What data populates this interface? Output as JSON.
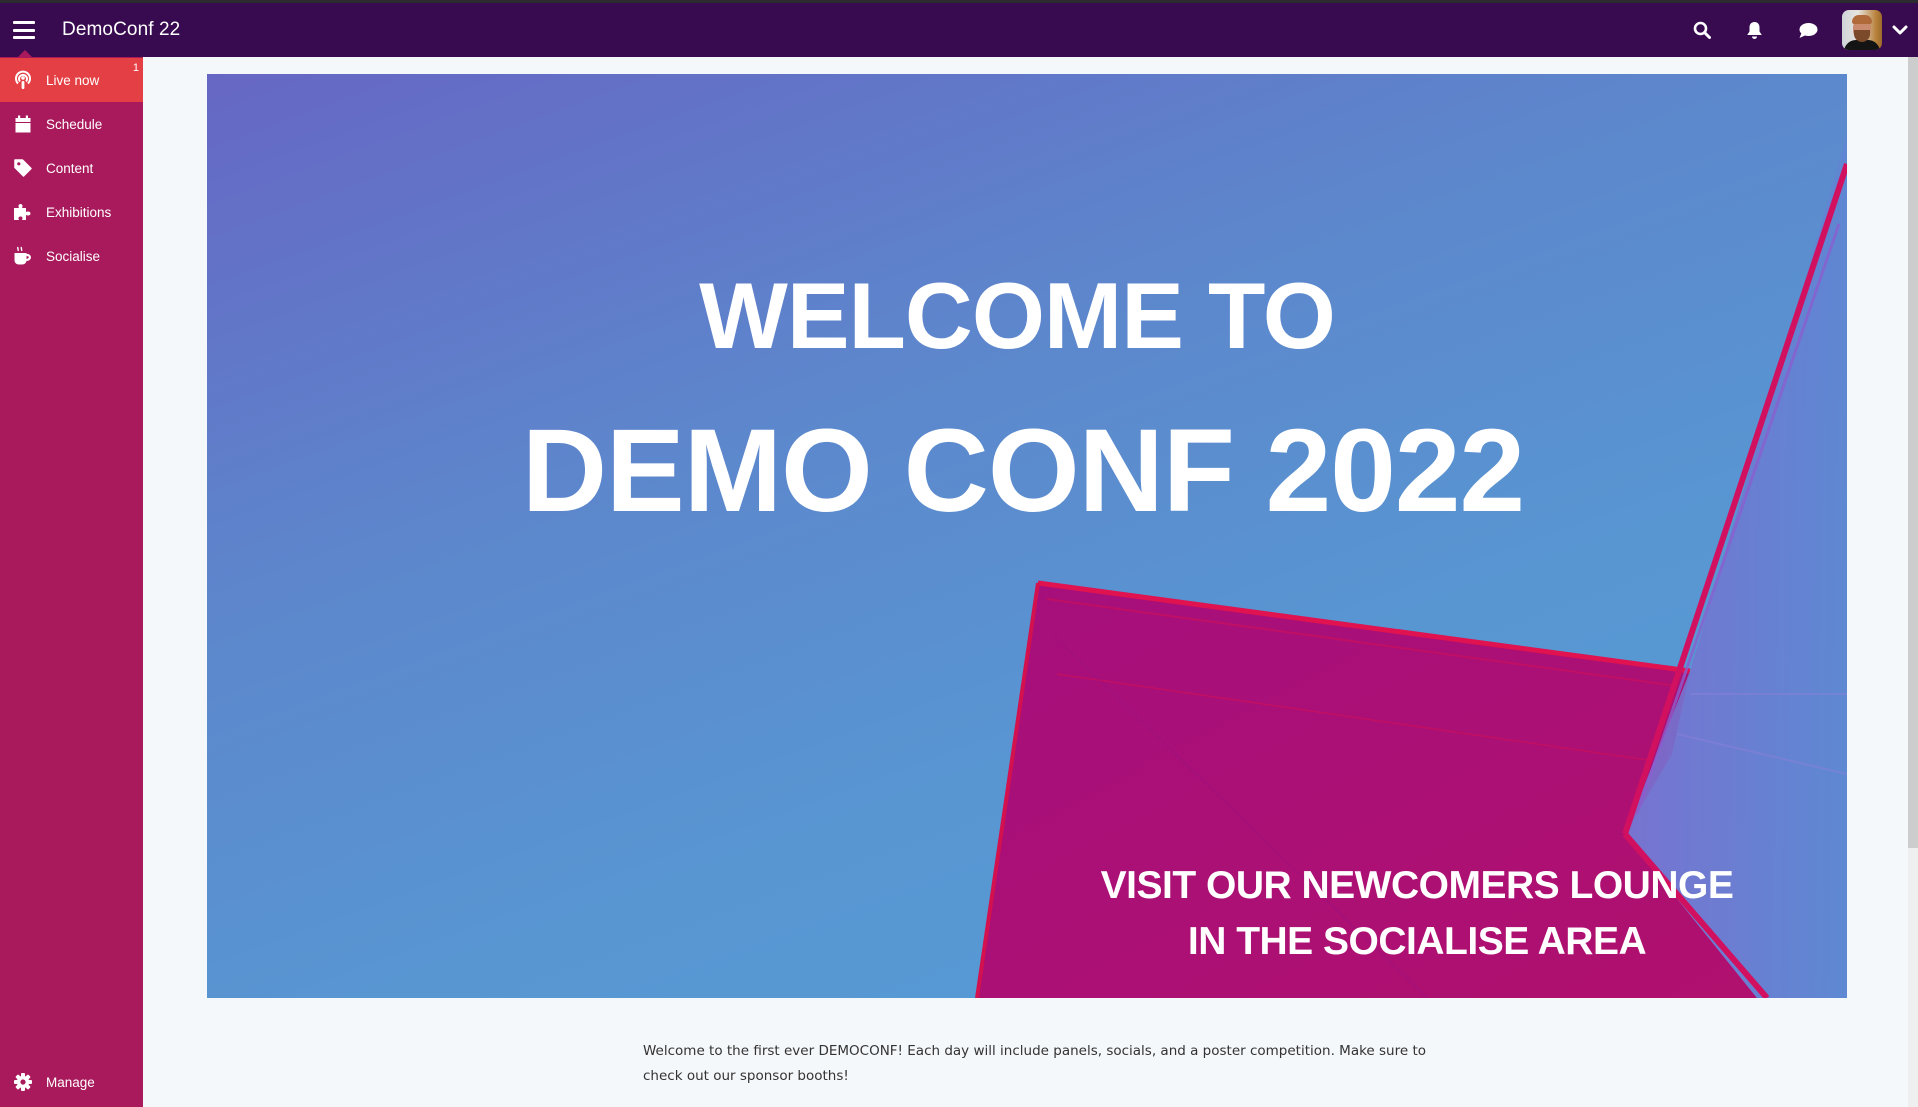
{
  "header": {
    "app_title": "DemoConf 22",
    "icons": {
      "menu": "hamburger-menu-icon",
      "search": "search-icon",
      "notifications": "bell-icon",
      "chat": "chat-bubble-icon",
      "account_menu": "chevron-down-icon"
    },
    "avatar_alt": "User avatar"
  },
  "sidebar": {
    "items": [
      {
        "label": "Live now",
        "icon": "podcast-icon",
        "badge": "1",
        "active": true
      },
      {
        "label": "Schedule",
        "icon": "calendar-icon"
      },
      {
        "label": "Content",
        "icon": "tag-icon"
      },
      {
        "label": "Exhibitions",
        "icon": "puzzle-piece-icon"
      },
      {
        "label": "Socialise",
        "icon": "coffee-cup-icon"
      }
    ],
    "footer": {
      "label": "Manage",
      "icon": "gear-icon"
    }
  },
  "banner": {
    "line1": "WELCOME TO",
    "line2": "DEMO CONF 2022",
    "callout_line1": "VISIT OUR NEWCOMERS LOUNGE",
    "callout_line2": "IN THE SOCIALISE AREA"
  },
  "intro": {
    "text": "Welcome to the first ever DEMOCONF! Each day will include panels, socials, and a poster competition. Make sure to check out our sponsor booths!"
  },
  "colors": {
    "header_bg": "#380b50",
    "sidebar_bg": "#a91a5c",
    "active_item_bg": "#e43f44",
    "page_bg": "#f5f8fb",
    "banner_blue": "#5896d2",
    "banner_magenta": "#a80e7a"
  }
}
